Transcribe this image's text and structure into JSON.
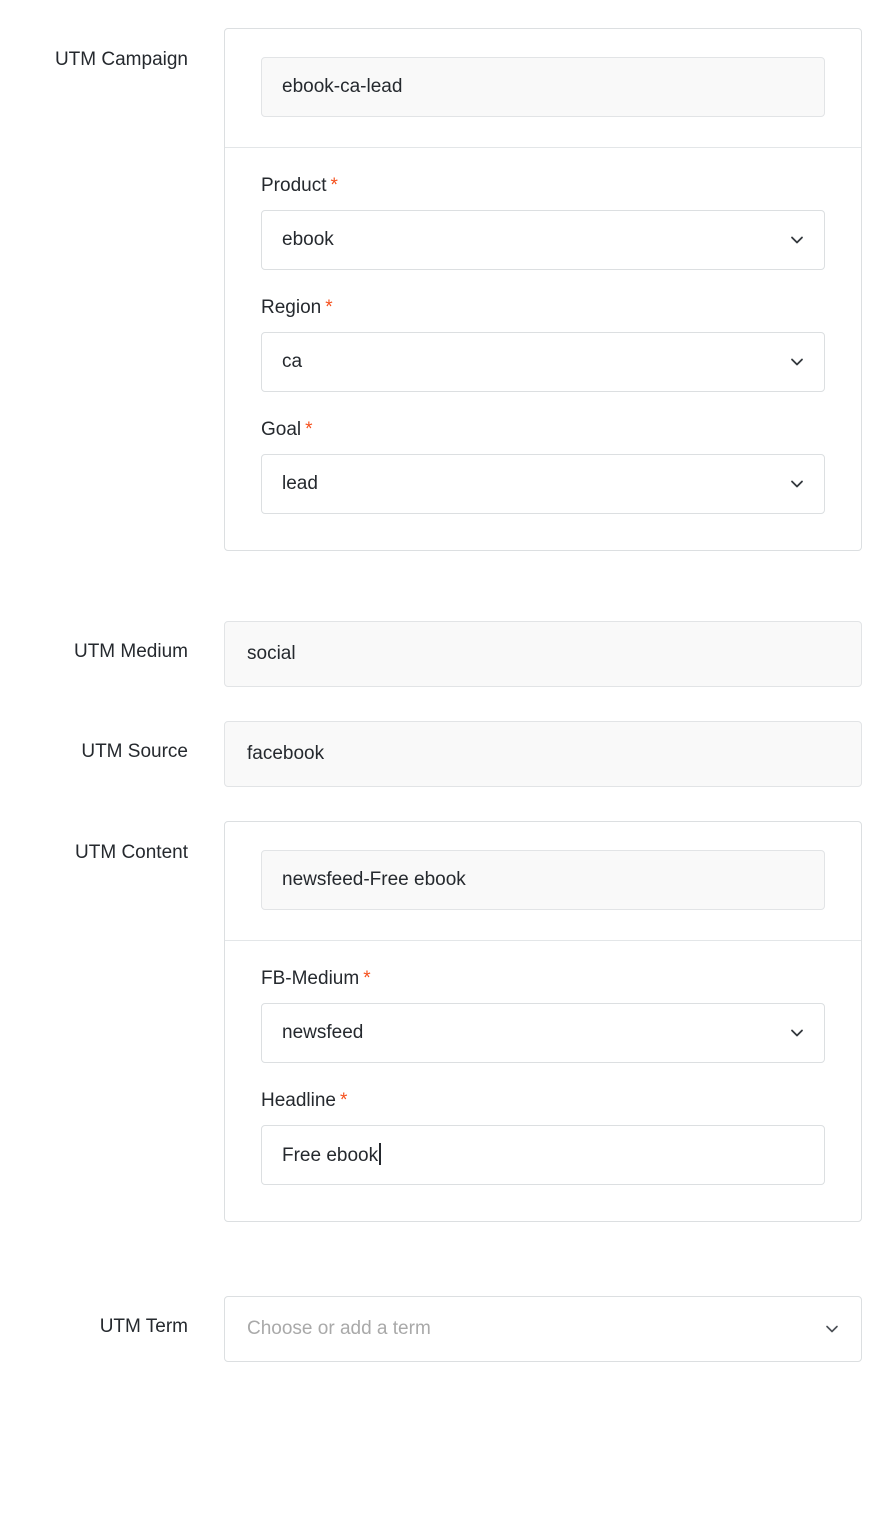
{
  "form": {
    "rows": [
      {
        "label": "UTM Campaign",
        "computed_value": "ebook-ca-lead",
        "subfields": [
          {
            "label": "Product",
            "required_mark": "*",
            "value": "ebook",
            "control": "select"
          },
          {
            "label": "Region",
            "required_mark": "*",
            "value": "ca",
            "control": "select"
          },
          {
            "label": "Goal",
            "required_mark": "*",
            "value": "lead",
            "control": "select"
          }
        ]
      },
      {
        "label": "UTM Medium",
        "value": "social"
      },
      {
        "label": "UTM Source",
        "value": "facebook"
      },
      {
        "label": "UTM Content",
        "computed_value": "newsfeed-Free ebook",
        "subfields": [
          {
            "label": "FB-Medium",
            "required_mark": "*",
            "value": "newsfeed",
            "control": "select"
          },
          {
            "label": "Headline",
            "required_mark": "*",
            "value": "Free ebook",
            "control": "text"
          }
        ]
      },
      {
        "label": "UTM Term",
        "placeholder": "Choose or add a term",
        "value": ""
      }
    ]
  },
  "icons": {
    "chevron_down": "chevron-down-icon"
  },
  "colors": {
    "required_asterisk": "#f5511e",
    "label_text": "#25292e",
    "readonly_background": "#f9f9f9",
    "border": "#dcdfe1",
    "placeholder_text": "#a9a9a9"
  }
}
